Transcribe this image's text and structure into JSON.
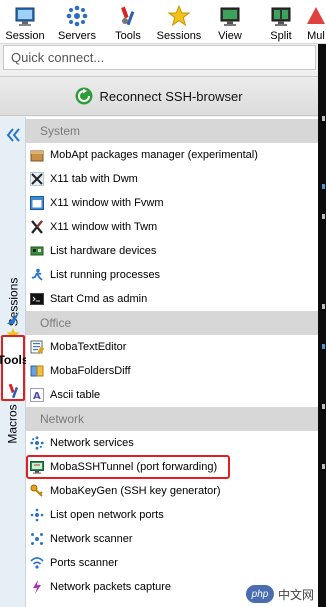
{
  "toolbar": {
    "buttons": [
      {
        "label": "Session",
        "icon": "session-icon"
      },
      {
        "label": "Servers",
        "icon": "servers-icon"
      },
      {
        "label": "Tools",
        "icon": "tools-icon"
      },
      {
        "label": "Sessions",
        "icon": "star-icon"
      },
      {
        "label": "View",
        "icon": "view-icon"
      },
      {
        "label": "Split",
        "icon": "split-icon"
      },
      {
        "label": "Mul",
        "icon": "multiexec-icon"
      }
    ]
  },
  "quick_connect": {
    "placeholder": "Quick connect..."
  },
  "reconnect": {
    "label": "Reconnect SSH-browser"
  },
  "sidebar": {
    "tabs": [
      {
        "label": "Sessions"
      },
      {
        "label": "Tools",
        "active": true
      },
      {
        "label": "Macros"
      }
    ]
  },
  "tools": {
    "sections": [
      {
        "title": "System",
        "items": [
          {
            "label": "MobApt packages manager (experimental)",
            "icon": "package-icon"
          },
          {
            "label": "X11 tab with Dwm",
            "icon": "x11-icon"
          },
          {
            "label": "X11 window with Fvwm",
            "icon": "window-icon"
          },
          {
            "label": "X11 window with Twm",
            "icon": "x11-icon"
          },
          {
            "label": "List hardware devices",
            "icon": "hardware-icon"
          },
          {
            "label": "List running processes",
            "icon": "running-icon"
          },
          {
            "label": "Start Cmd as admin",
            "icon": "cmd-icon"
          }
        ]
      },
      {
        "title": "Office",
        "items": [
          {
            "label": "MobaTextEditor",
            "icon": "text-editor-icon"
          },
          {
            "label": "MobaFoldersDiff",
            "icon": "folders-diff-icon"
          },
          {
            "label": "Ascii table",
            "icon": "ascii-icon"
          }
        ]
      },
      {
        "title": "Network",
        "items": [
          {
            "label": "Network services",
            "icon": "network-services-icon"
          },
          {
            "label": "MobaSSHTunnel (port forwarding)",
            "icon": "ssh-tunnel-icon",
            "highlighted": true
          },
          {
            "label": "MobaKeyGen (SSH key generator)",
            "icon": "key-icon"
          },
          {
            "label": "List open network ports",
            "icon": "ports-icon"
          },
          {
            "label": "Network scanner",
            "icon": "network-scanner-icon"
          },
          {
            "label": "Ports scanner",
            "icon": "wifi-icon"
          },
          {
            "label": "Network packets capture",
            "icon": "packets-icon"
          }
        ]
      }
    ]
  },
  "watermark": {
    "logo": "php",
    "text": "中文网"
  },
  "colors": {
    "highlight_border": "#e02020",
    "section_bg": "#d7d7d7",
    "section_text": "#7a7a7a",
    "sidebar_bg": "#e6eef6"
  }
}
